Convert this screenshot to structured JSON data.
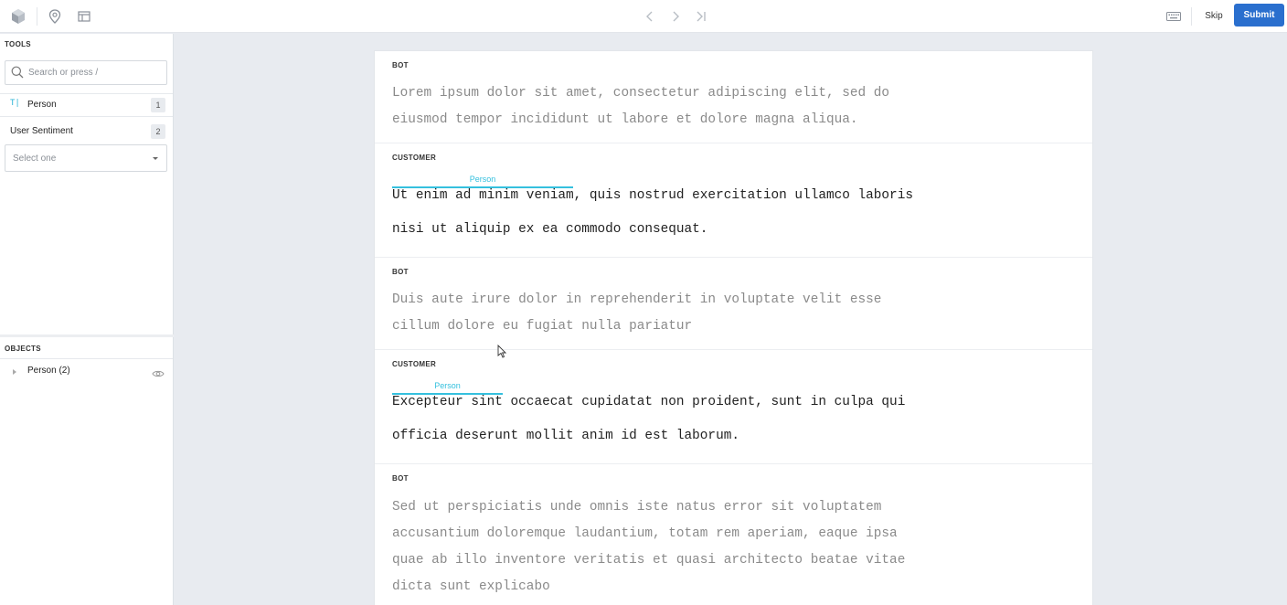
{
  "toolbar": {
    "skip_label": "Skip",
    "submit_label": "Submit",
    "accent": "#2a6fce"
  },
  "sidebar": {
    "tools_title": "TOOLS",
    "search_placeholder": "Search or press /",
    "tools": [
      {
        "glyph": "T|",
        "label": "Person",
        "count": "1"
      },
      {
        "label": "User Sentiment",
        "count": "2"
      }
    ],
    "select_value": "Select one",
    "objects_title": "OBJECTS",
    "objects": [
      {
        "label": "Person (2)"
      }
    ]
  },
  "conversation": [
    {
      "speaker": "BOT",
      "lines": [
        "Lorem ipsum dolor sit amet, consectetur adipiscing elit, sed do",
        "eiusmod tempor incididunt ut labore et dolore magna aliqua."
      ]
    },
    {
      "speaker": "CUSTOMER",
      "annotation": "Person",
      "lines": [
        "Ut enim ad minim veniam, quis nostrud exercitation ullamco laboris",
        "nisi ut aliquip ex ea commodo consequat."
      ]
    },
    {
      "speaker": "BOT",
      "lines": [
        "Duis aute irure dolor in reprehenderit in voluptate velit esse",
        "cillum dolore eu fugiat nulla pariatur"
      ]
    },
    {
      "speaker": "CUSTOMER",
      "annotation": "Person",
      "lines": [
        "Excepteur sint occaecat cupidatat non proident, sunt in culpa qui",
        "officia deserunt mollit anim id est laborum."
      ]
    },
    {
      "speaker": "BOT",
      "lines": [
        "Sed ut perspiciatis unde omnis iste natus error sit voluptatem",
        "accusantium doloremque laudantium, totam rem aperiam, eaque ipsa",
        "quae ab illo inventore veritatis et quasi architecto beatae vitae",
        "dicta sunt explicabo"
      ]
    }
  ],
  "colors": {
    "annotation": "#35c0de"
  }
}
